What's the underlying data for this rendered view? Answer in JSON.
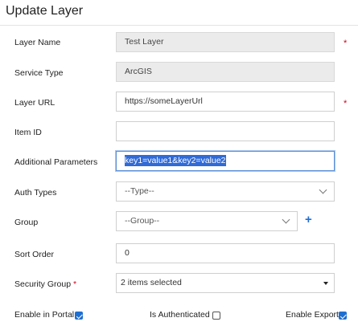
{
  "title": "Update Layer",
  "fields": {
    "layer_name": {
      "label": "Layer Name",
      "value": "Test Layer"
    },
    "service_type": {
      "label": "Service Type",
      "value": "ArcGIS"
    },
    "layer_url": {
      "label": "Layer URL",
      "value": "https://someLayerUrl"
    },
    "item_id": {
      "label": "Item ID",
      "value": ""
    },
    "additional_parameters": {
      "label": "Additional Parameters",
      "value": "key1=value1&key2=value2"
    },
    "auth_types": {
      "label": "Auth Types",
      "value": "--Type--"
    },
    "group": {
      "label": "Group",
      "value": "--Group--",
      "add_symbol": "+"
    },
    "sort_order": {
      "label": "Sort Order",
      "value": "0"
    },
    "security_group": {
      "label": "Security Group",
      "value": "2 items selected"
    }
  },
  "required_marker": "*",
  "checkboxes": {
    "enable_in_portal": {
      "label": "Enable in Portal",
      "checked": true
    },
    "is_authenticated": {
      "label": "Is Authenticated",
      "checked": false
    },
    "enable_export": {
      "label": "Enable Export",
      "checked": true
    }
  },
  "colors": {
    "accent": "#1f6fd1",
    "required": "#d0021b",
    "selection": "#2f6ad7"
  }
}
